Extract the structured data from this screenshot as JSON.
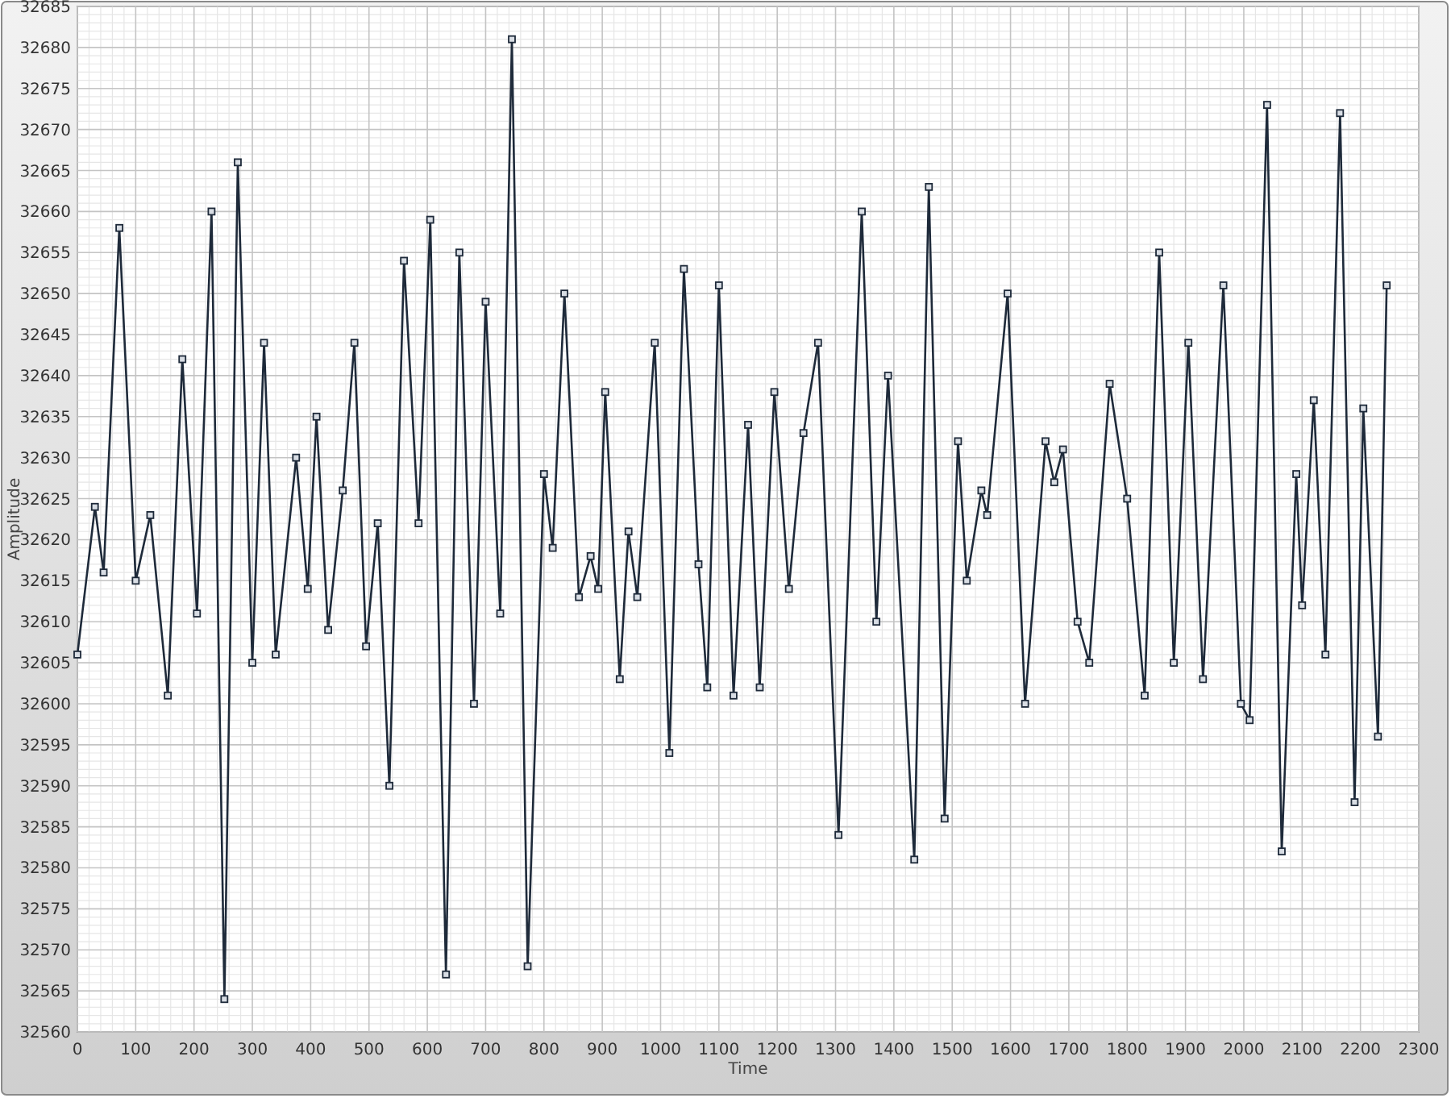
{
  "chart_data": {
    "type": "line",
    "xlabel": "Time",
    "ylabel": "Amplitude",
    "xlim": [
      0,
      2300
    ],
    "ylim": [
      32560,
      32685
    ],
    "xticks": [
      0,
      100,
      200,
      300,
      400,
      500,
      600,
      700,
      800,
      900,
      1000,
      1100,
      1200,
      1300,
      1400,
      1500,
      1600,
      1700,
      1800,
      1900,
      2000,
      2100,
      2200,
      2300
    ],
    "yticks": [
      32560,
      32565,
      32570,
      32575,
      32580,
      32585,
      32590,
      32595,
      32600,
      32605,
      32610,
      32615,
      32620,
      32625,
      32630,
      32635,
      32640,
      32645,
      32650,
      32655,
      32660,
      32665,
      32670,
      32675,
      32680,
      32685
    ],
    "x": [
      0,
      30,
      45,
      72,
      100,
      125,
      155,
      180,
      205,
      230,
      252,
      275,
      300,
      320,
      340,
      375,
      395,
      410,
      430,
      455,
      475,
      495,
      515,
      535,
      560,
      585,
      605,
      632,
      655,
      680,
      700,
      725,
      745,
      772,
      800,
      815,
      835,
      860,
      880,
      893,
      905,
      930,
      945,
      960,
      990,
      1015,
      1040,
      1065,
      1080,
      1100,
      1125,
      1150,
      1170,
      1195,
      1220,
      1245,
      1270,
      1305,
      1345,
      1370,
      1390,
      1435,
      1460,
      1487,
      1510,
      1525,
      1550,
      1560,
      1595,
      1625,
      1660,
      1675,
      1690,
      1715,
      1735,
      1770,
      1800,
      1830,
      1855,
      1880,
      1905,
      1930,
      1965,
      1995,
      2010,
      2040,
      2065,
      2090,
      2100,
      2120,
      2140,
      2165,
      2190,
      2205,
      2230,
      2245
    ],
    "grid": true,
    "series": [
      {
        "color": "#1e2a3a",
        "marker": "square",
        "values": [
          32606,
          32624,
          32616,
          32658,
          32615,
          32623,
          32601,
          32642,
          32611,
          32660,
          32564,
          32666,
          32605,
          32644,
          32606,
          32630,
          32614,
          32635,
          32609,
          32626,
          32644,
          32607,
          32622,
          32590,
          32654,
          32622,
          32659,
          32567,
          32655,
          32600,
          32649,
          32611,
          32681,
          32568,
          32628,
          32619,
          32650,
          32613,
          32618,
          32614,
          32638,
          32603,
          32621,
          32613,
          32644,
          32594,
          32653,
          32617,
          32602,
          32651,
          32601,
          32634,
          32602,
          32638,
          32614,
          32633,
          32644,
          32584,
          32660,
          32610,
          32640,
          32581,
          32663,
          32586,
          32632,
          32615,
          32626,
          32623,
          32650,
          32600,
          32632,
          32627,
          32631,
          32610,
          32605,
          32639,
          32625,
          32601,
          32655,
          32605,
          32644,
          32603,
          32651,
          32600,
          32598,
          32673,
          32582,
          32628,
          32612,
          32637,
          32606,
          32672,
          32588,
          32636,
          32596,
          32651
        ]
      }
    ]
  }
}
